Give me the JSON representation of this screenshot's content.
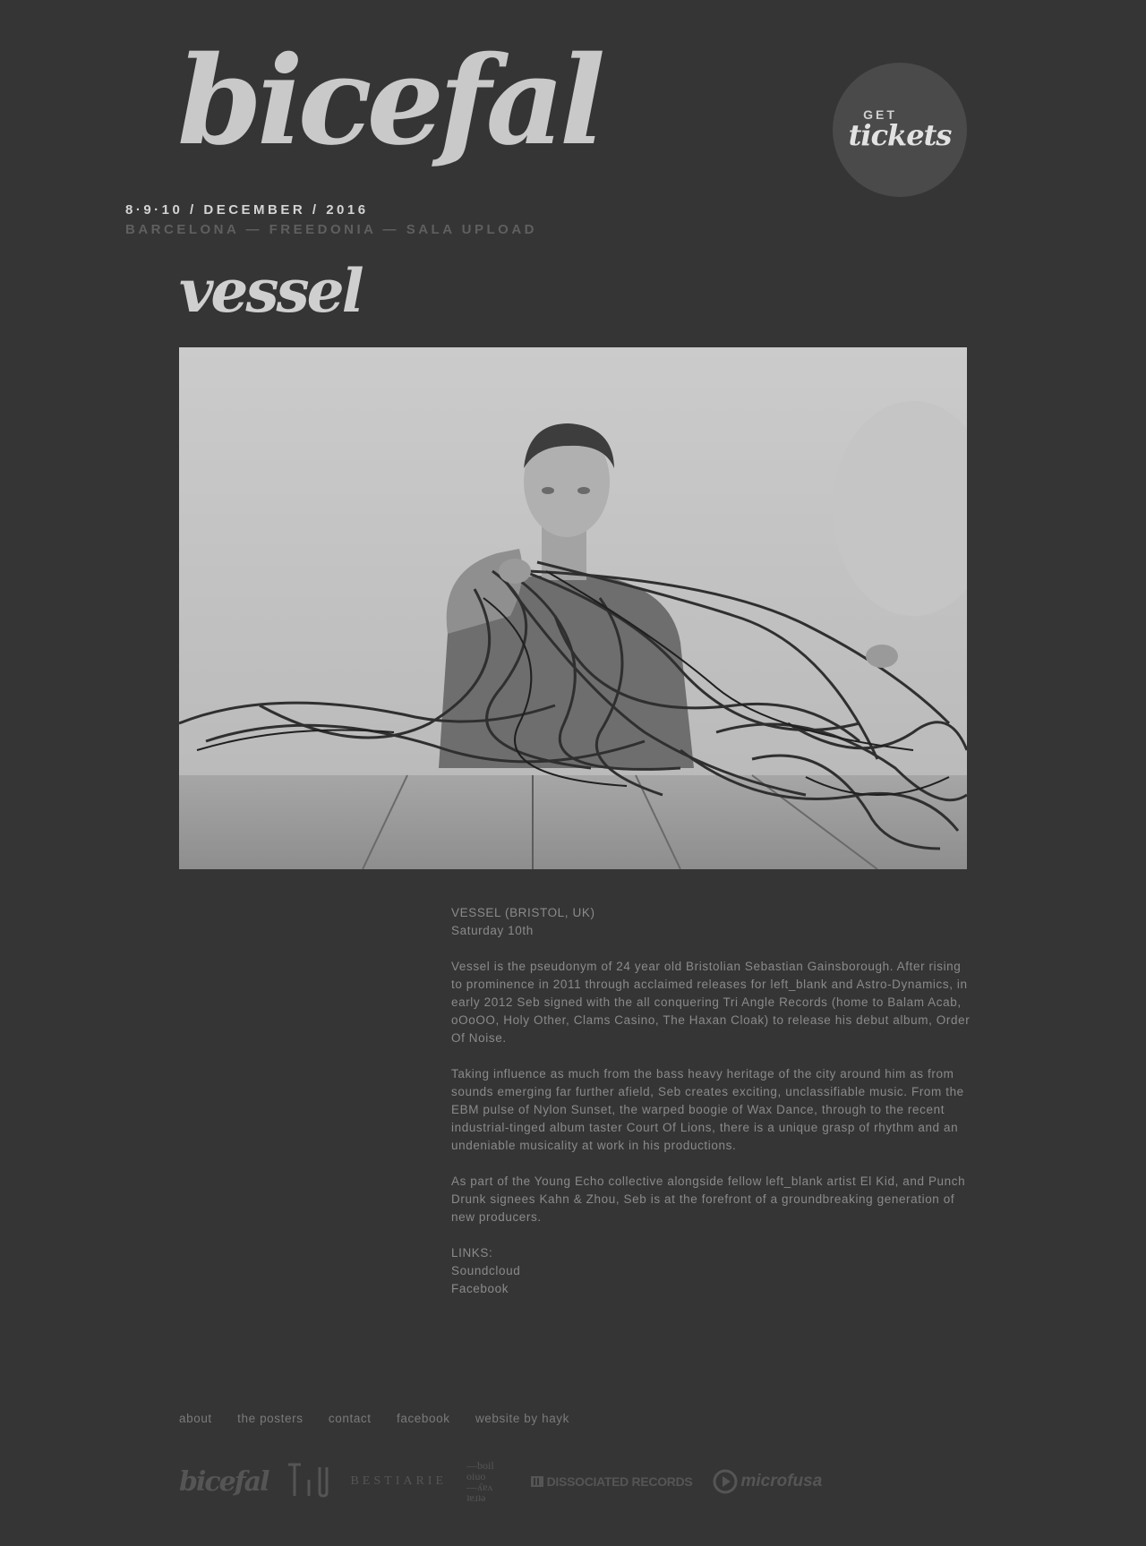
{
  "header": {
    "logo_text": "bicefal",
    "tickets_get": "GET",
    "tickets_word": "tickets",
    "dates": "8·9·10 / DECEMBER / 2016",
    "venue": "BARCELONA — FREEDONIA — SALA UPLOAD"
  },
  "artist": {
    "title": "vessel",
    "heading": "VESSEL (BRISTOL, UK)",
    "day": "Saturday 10th",
    "paragraphs": [
      "Vessel is the pseudonym of 24 year old Bristolian Sebastian Gainsborough. After rising to prominence in 2011 through acclaimed releases for left_blank and Astro-Dynamics, in early 2012 Seb signed with the all conquering Tri Angle Records (home to Balam Acab, oOoOO, Holy Other, Clams Casino, The Haxan Cloak) to release his debut album, Order Of Noise.",
      "Taking influence as much from the bass heavy heritage of the city around him as from sounds emerging far further afield, Seb creates exciting, unclassifiable music. From the EBM pulse of Nylon Sunset, the warped boogie of Wax Dance, through to the recent industrial-tinged album taster Court Of Lions, there is a unique grasp of rhythm and an undeniable musicality at work in his productions.",
      "As part of the Young Echo collective alongside fellow left_blank artist El Kid, and Punch Drunk signees Kahn & Zhou, Seb is at the forefront of a groundbreaking generation of new producers."
    ],
    "links_label": "LINKS:",
    "links": [
      "Soundcloud",
      "Facebook"
    ]
  },
  "footer": {
    "nav": [
      "about",
      "the posters",
      "contact",
      "facebook",
      "website by hayk"
    ],
    "partners": {
      "bicefal": "bicefal",
      "bestiarie": "BESTIARIE",
      "poil": [
        "—boil",
        "oiuo",
        "—ʎɐʌ",
        "ʇɐɹʇǝ"
      ],
      "dissociated": "DISSOCIATED RECORDS",
      "microfusa": "microfusa"
    }
  },
  "colors": {
    "background": "#353535",
    "text": "#cfcfcf",
    "muted": "#8a8a8a",
    "tickets_circle": "#4a4a4a"
  },
  "icons": [
    "tri-angle-logo-icon",
    "dissociated-records-icon",
    "microfusa-play-icon"
  ]
}
